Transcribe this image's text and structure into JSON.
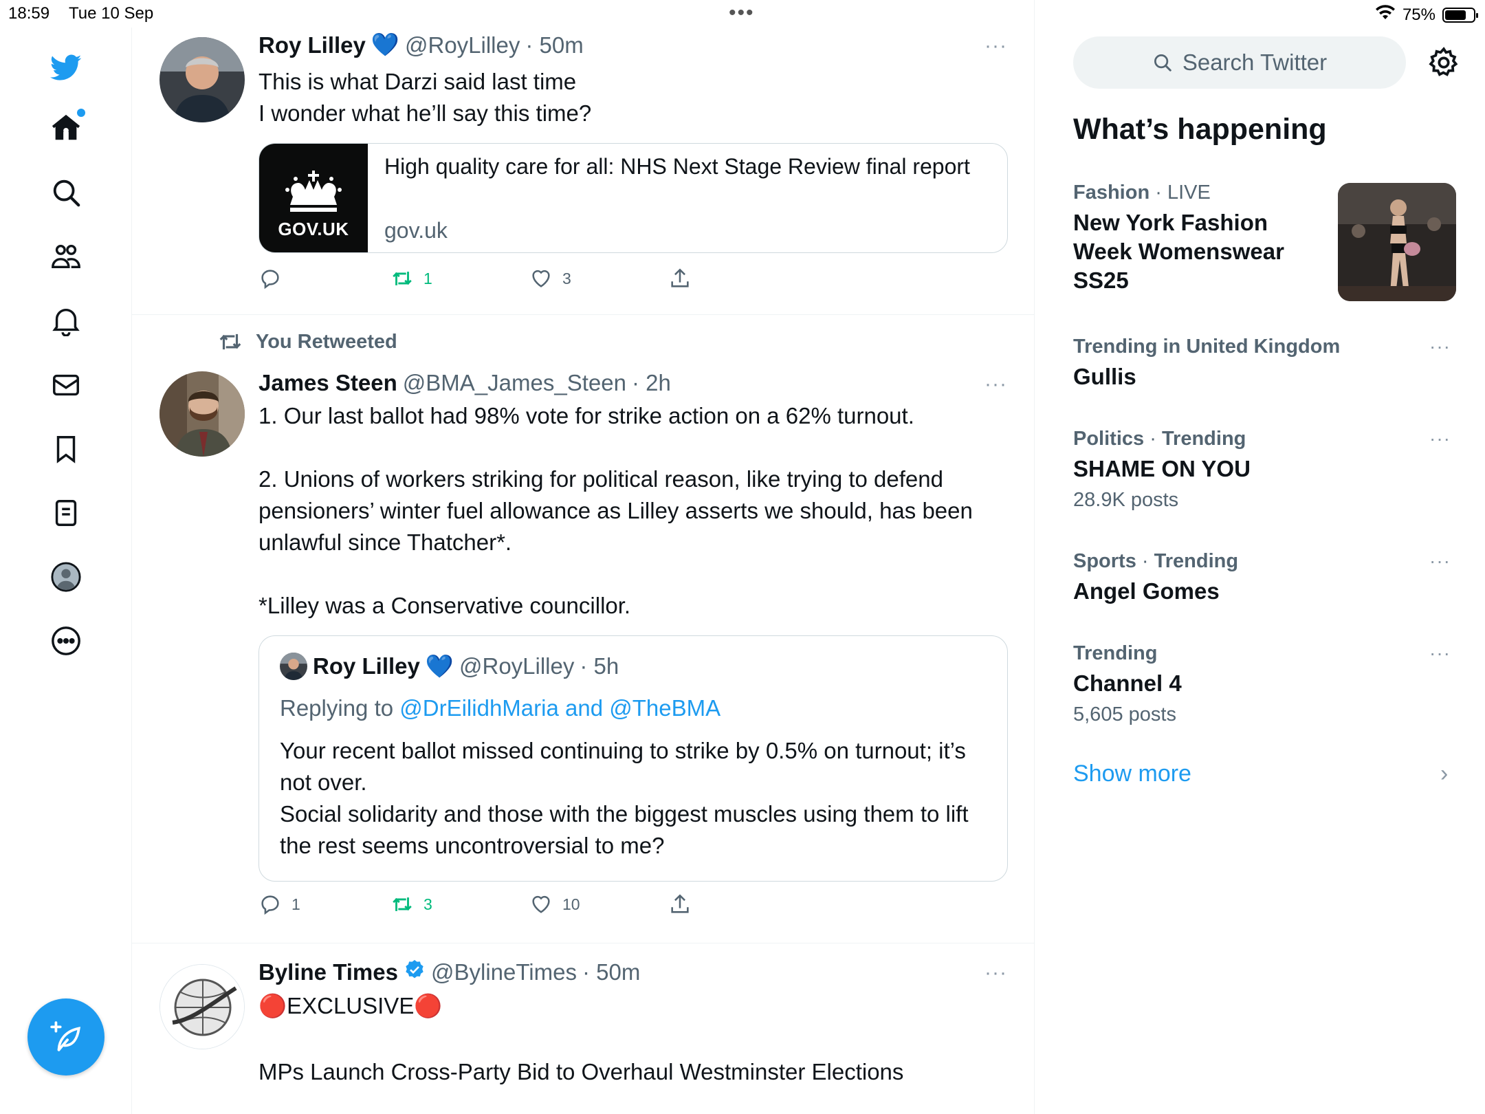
{
  "status_bar": {
    "time": "18:59",
    "date": "Tue 10 Sep",
    "battery": "75%",
    "battery_level": 0.75,
    "multitask_dots": "•••"
  },
  "nav": {
    "items": [
      "twitter-logo",
      "home",
      "explore",
      "communities",
      "notifications",
      "messages",
      "bookmarks",
      "lists",
      "profile",
      "more"
    ]
  },
  "timeline": {
    "tweets": [
      {
        "name": "Roy Lilley",
        "badge": "💙",
        "handle": "@RoyLilley",
        "time": "· 50m",
        "more": "···",
        "text": "This is what Darzi said last time\nI wonder what he’ll say this time?",
        "card": {
          "thumb_label": "GOV.UK",
          "title": "High quality care for all: NHS Next Stage Review final report",
          "domain": "gov.uk"
        },
        "replies": "",
        "retweets": "1",
        "likes": "3"
      },
      {
        "social_context": "You Retweeted",
        "name": "James Steen",
        "handle": "@BMA_James_Steen",
        "time": "· 2h",
        "more": "···",
        "text": "1. Our last ballot had 98% vote for strike action on a 62% turnout.\n\n2. Unions of workers striking for political reason, like trying to defend pensioners’ winter fuel allowance as Lilley asserts we should, has been unlawful since Thatcher*.\n\n*Lilley was a Conservative councillor.",
        "quote": {
          "name": "Roy Lilley",
          "badge": "💙",
          "handle": "@RoyLilley",
          "time": "· 5h",
          "replying_prefix": "Replying to ",
          "replying_to": "@DrEilidhMaria and @TheBMA",
          "text": "Your recent ballot missed continuing to strike by 0.5% on turnout; it’s not over.\nSocial solidarity and those with the biggest muscles using them to lift the rest seems uncontroversial to me?"
        },
        "replies": "1",
        "retweets": "3",
        "likes": "10"
      },
      {
        "name": "Byline Times",
        "handle": "@BylineTimes",
        "time": "· 50m",
        "more": "···",
        "text_line1_emoji": "🔴",
        "text_line1": "EXCLUSIVE",
        "text_line2": "MPs Launch Cross-Party Bid to Overhaul Westminster Elections"
      }
    ]
  },
  "sidebar": {
    "search_placeholder": "Search Twitter",
    "whats_happening": "What’s happening",
    "trends": [
      {
        "category": "Fashion",
        "sep": " · ",
        "context": "LIVE",
        "topic": "New York Fashion Week Womenswear SS25",
        "posts": ""
      },
      {
        "category": "",
        "sep": "",
        "context": "Trending in United Kingdom",
        "topic": "Gullis",
        "posts": ""
      },
      {
        "category": "Politics",
        "sep": " · ",
        "context": "Trending",
        "topic": "SHAME ON YOU",
        "posts": "28.9K posts"
      },
      {
        "category": "Sports",
        "sep": " · ",
        "context": "Trending",
        "topic": "Angel Gomes",
        "posts": ""
      },
      {
        "category": "",
        "sep": "",
        "context": "Trending",
        "topic": "Channel 4",
        "posts": "5,605 posts"
      }
    ],
    "trend_more": "···",
    "show_more": "Show more",
    "show_more_chevron": "›"
  },
  "colors": {
    "accent": "#1d9bf0",
    "retweet_green": "#00ba7c",
    "secondary_text": "#536471",
    "border": "#eff3f4"
  }
}
